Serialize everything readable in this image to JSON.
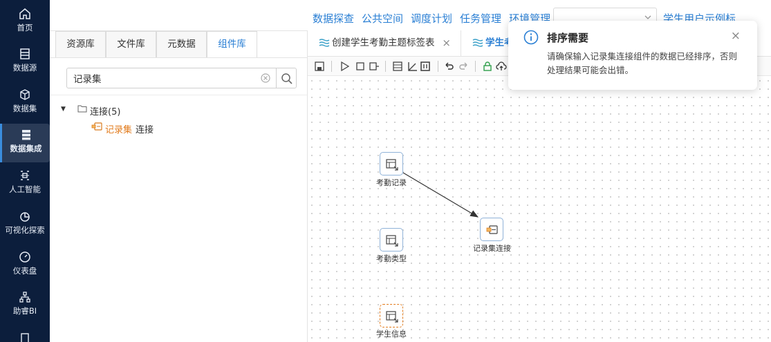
{
  "nav": {
    "items": [
      {
        "label": "首页",
        "icon": "home-icon"
      },
      {
        "label": "数据源",
        "icon": "database-icon"
      },
      {
        "label": "数据集",
        "icon": "cube-icon"
      },
      {
        "label": "数据集成",
        "icon": "server-icon"
      },
      {
        "label": "人工智能",
        "icon": "ai-icon"
      },
      {
        "label": "可视化探索",
        "icon": "pie-chart-icon"
      },
      {
        "label": "仪表盘",
        "icon": "gauge-icon"
      },
      {
        "label": "助睿BI",
        "icon": "org-chart-icon"
      }
    ],
    "active": "数据集成"
  },
  "topbar": {
    "links": [
      "数据探查",
      "公共空间",
      "调度计划",
      "任务管理",
      "环境管理"
    ],
    "select_value": "",
    "right_link": "学生用户示例标"
  },
  "left_panel": {
    "tabs": [
      "资源库",
      "文件库",
      "元数据",
      "组件库"
    ],
    "active_tab": "组件库",
    "search": {
      "value": "记录集",
      "placeholder": ""
    },
    "tree": {
      "folder_label": "连接(5)",
      "leaf_highlight": "记录集",
      "leaf_rest": "连接"
    }
  },
  "editor": {
    "tabs": [
      {
        "label": "创建学生考勤主题标签表",
        "close": "×"
      },
      {
        "label": "学生考",
        "close": ""
      }
    ],
    "nodes": [
      {
        "label": "考勤记录",
        "kind": "table-input"
      },
      {
        "label": "记录集连接",
        "kind": "join"
      },
      {
        "label": "考勤类型",
        "kind": "table-input"
      },
      {
        "label": "学生信息",
        "kind": "table-input"
      }
    ]
  },
  "toast": {
    "title": "排序需要",
    "message": "请确保输入记录集连接组件的数据已经排序，否则处理结果可能会出错。",
    "close": "×"
  },
  "colors": {
    "nav_bg": "#0c1e3c",
    "accent": "#2a7fd4",
    "highlight": "#e27b1c"
  }
}
